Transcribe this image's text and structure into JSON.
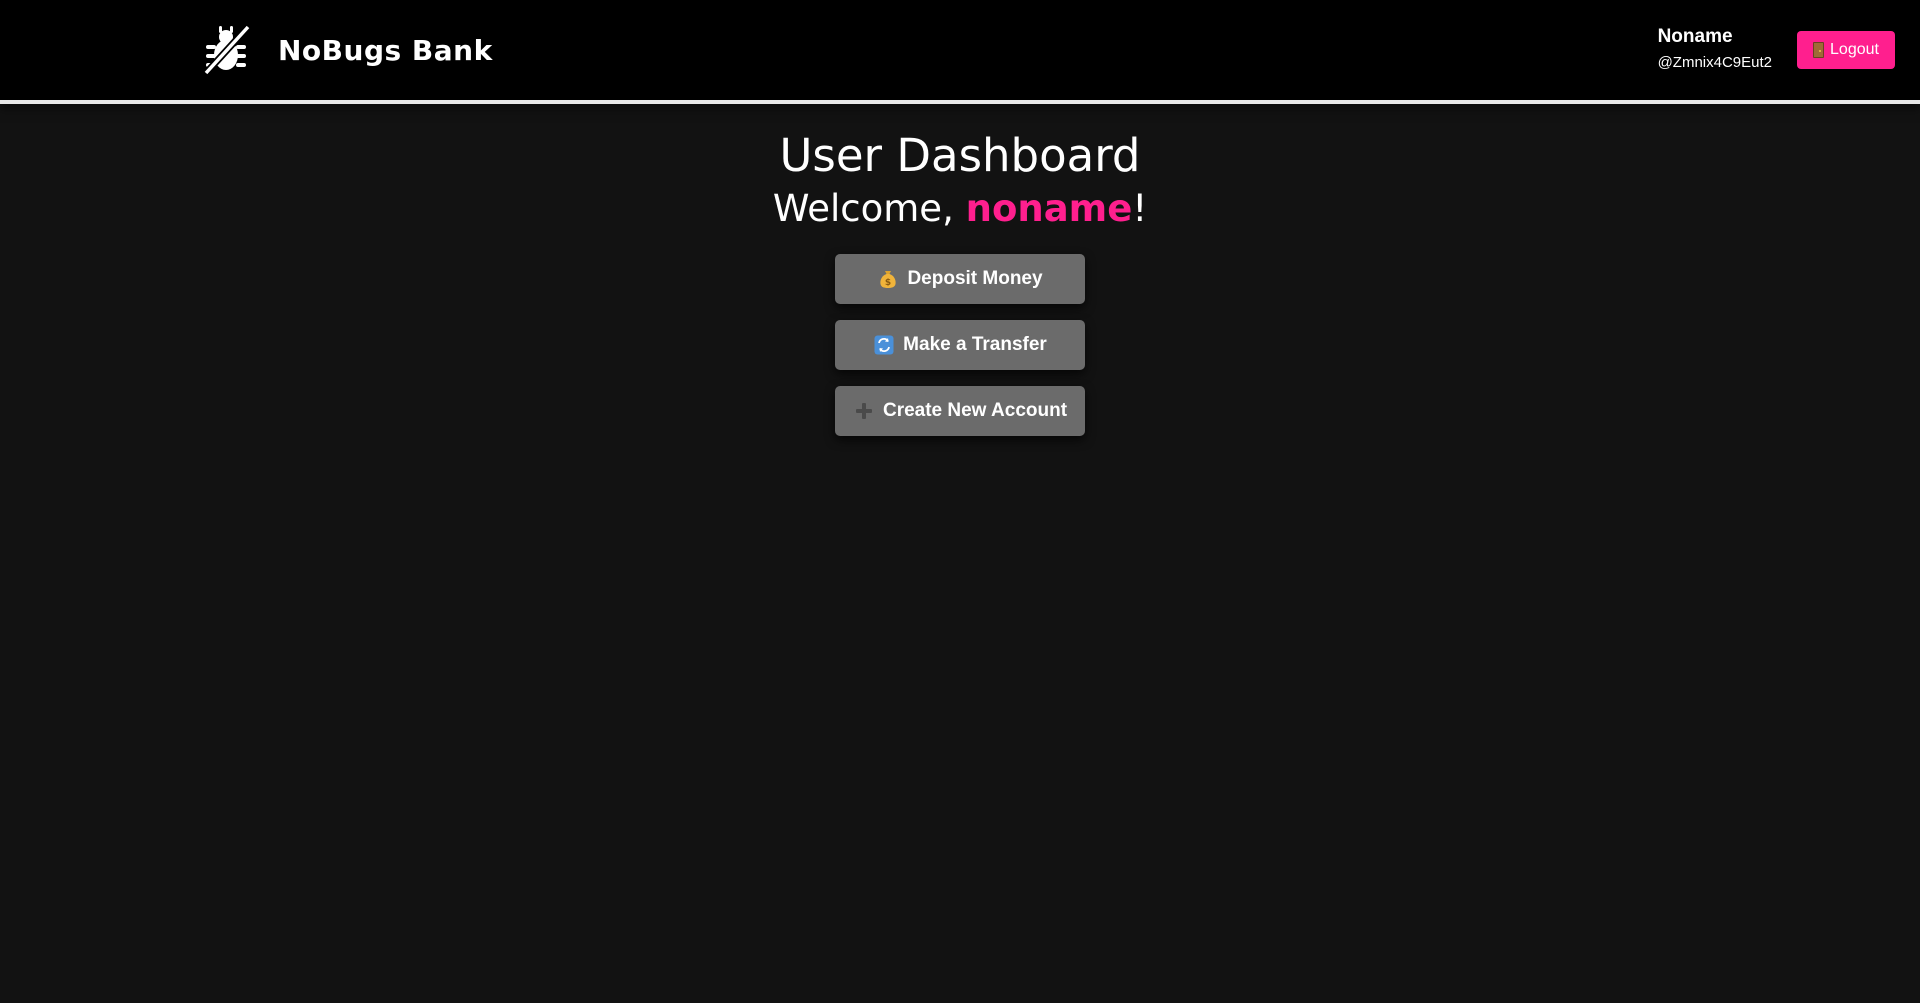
{
  "header": {
    "brand_name": "NoBugs Bank",
    "logo_icon": "bug-crossed-icon",
    "user": {
      "name": "Noname",
      "handle": "@Zmnix4C9Eut2"
    },
    "logout": {
      "label": "Logout",
      "icon": "door-icon"
    }
  },
  "main": {
    "title": "User Dashboard",
    "welcome_prefix": "Welcome, ",
    "welcome_name": "noname",
    "welcome_suffix": "!",
    "actions": [
      {
        "label": "Deposit Money",
        "icon": "money-bag-icon"
      },
      {
        "label": "Make a Transfer",
        "icon": "transfer-arrows-icon"
      },
      {
        "label": "Create New Account",
        "icon": "plus-icon"
      }
    ]
  },
  "colors": {
    "accent": "#ff1f8e",
    "header_bg": "#000000",
    "page_bg": "#121212",
    "button_bg": "#6b6b6b"
  }
}
